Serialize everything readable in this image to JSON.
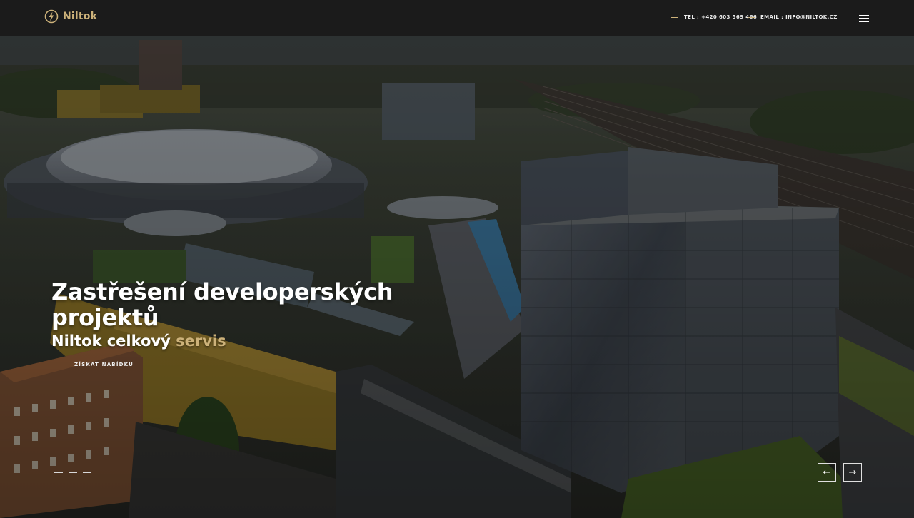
{
  "brand": {
    "name": "Niltok"
  },
  "header": {
    "tel": "TEL : +420 603 569 466",
    "email": "EMAIL : INFO@NILTOK.CZ"
  },
  "hero": {
    "title": "Zastřešení developerských projektů",
    "subtitle_main": "Niltok celkový",
    "subtitle_accent": "servis",
    "cta": "ZÍSKAT NABÍDKU"
  },
  "slider": {
    "prev": "←",
    "next": "→"
  },
  "colors": {
    "accent": "#cdb27a",
    "bar": "#1b1b1b"
  }
}
